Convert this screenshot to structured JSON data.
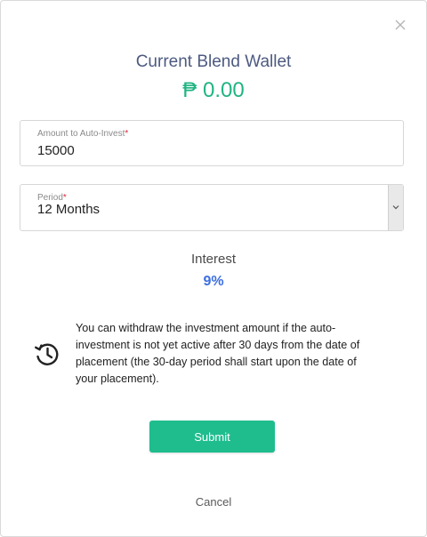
{
  "modal": {
    "title": "Current Blend Wallet",
    "balance": "₱ 0.00"
  },
  "amount_field": {
    "label": "Amount to Auto-Invest",
    "required_mark": "*",
    "value": "15000"
  },
  "period_field": {
    "label": "Period",
    "required_mark": "*",
    "selected": "12 Months"
  },
  "interest": {
    "label": "Interest",
    "value": "9%"
  },
  "notice": {
    "icon": "history-icon",
    "text": "You can withdraw the investment amount if the auto-investment is not yet active after 30 days from the date of placement (the 30-day period shall start upon the date of your placement)."
  },
  "actions": {
    "submit_label": "Submit",
    "cancel_label": "Cancel"
  },
  "colors": {
    "title": "#4d5a80",
    "balance": "#20b483",
    "interest_value": "#3d6fe0",
    "submit_bg": "#1fbd8e",
    "required": "#e0263d"
  }
}
